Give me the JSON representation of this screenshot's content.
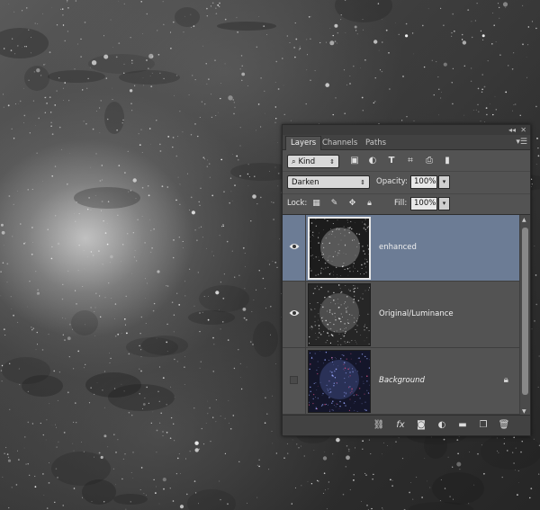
{
  "panel": {
    "tabs": [
      {
        "label": "Layers",
        "active": true
      },
      {
        "label": "Channels",
        "active": false
      },
      {
        "label": "Paths",
        "active": false
      }
    ],
    "filter": {
      "kind_label": "Kind"
    },
    "blend": {
      "mode": "Darken",
      "opacity_label": "Opacity:",
      "opacity_value": "100%",
      "fill_label": "Fill:",
      "fill_value": "100%",
      "lock_label": "Lock:"
    },
    "layers": [
      {
        "name": "enhanced",
        "visible": true,
        "selected": true,
        "italic": false,
        "locked": false
      },
      {
        "name": "Original/Luminance",
        "visible": true,
        "selected": false,
        "italic": false,
        "locked": false
      },
      {
        "name": "Background",
        "visible": false,
        "selected": false,
        "italic": true,
        "locked": true
      }
    ],
    "footer_icons": [
      "link-icon",
      "fx-icon",
      "mask-icon",
      "adjustment-icon",
      "folder-icon",
      "new-layer-icon",
      "trash-icon"
    ],
    "accent_selected": "#6c7c95"
  }
}
